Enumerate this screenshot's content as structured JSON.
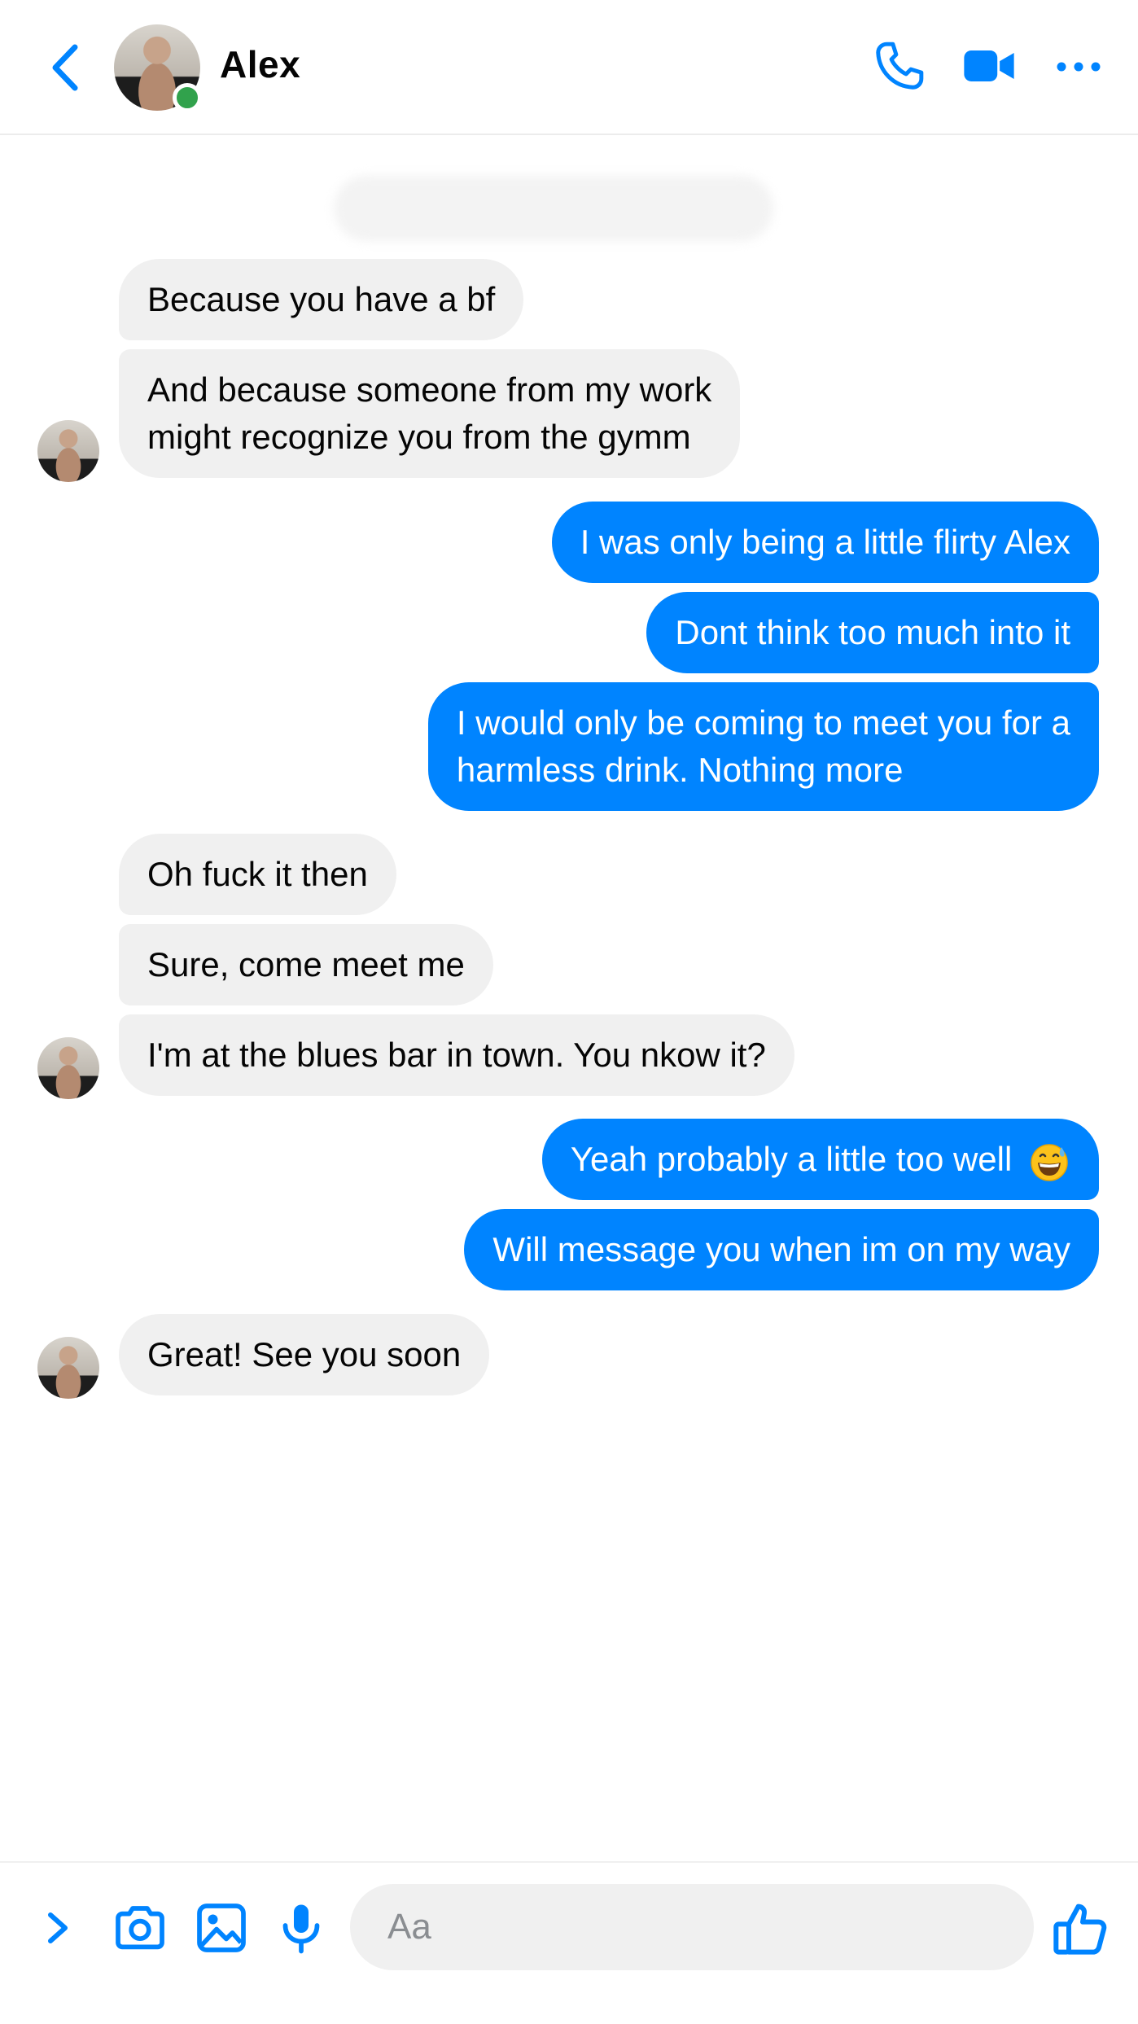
{
  "header": {
    "contact_name": "Alex",
    "online": true,
    "icons": [
      "back-icon",
      "phone-icon",
      "video-camera-icon",
      "more-icon"
    ]
  },
  "colors": {
    "accent": "#0084ff",
    "incoming_bubble": "#f0f0f0",
    "online": "#31a24c"
  },
  "messages": [
    {
      "side": "in",
      "text": "Because you have a bf"
    },
    {
      "side": "in",
      "line1": "And because someone from my work",
      "line2": "might recognize you from the gymm"
    },
    {
      "side": "out",
      "text": "I was only being a little flirty Alex"
    },
    {
      "side": "out",
      "text": "Dont think too much into it"
    },
    {
      "side": "out",
      "line1": "I would only be coming to meet you for a",
      "line2": "harmless drink. Nothing more"
    },
    {
      "side": "in",
      "text": "Oh fuck it then"
    },
    {
      "side": "in",
      "text": "Sure, come meet me"
    },
    {
      "side": "in",
      "text": "I'm at the blues bar in town. You nkow it?"
    },
    {
      "side": "out",
      "text": "Yeah probably a little too well",
      "emoji": "grinning-sweat-emoji"
    },
    {
      "side": "out",
      "text": "Will message you when im on my way"
    },
    {
      "side": "in",
      "text": "Great! See you soon"
    }
  ],
  "composer": {
    "placeholder": "Aa",
    "icons": [
      "chevron-right-icon",
      "camera-icon",
      "image-icon",
      "microphone-icon",
      "thumbs-up-icon"
    ]
  }
}
